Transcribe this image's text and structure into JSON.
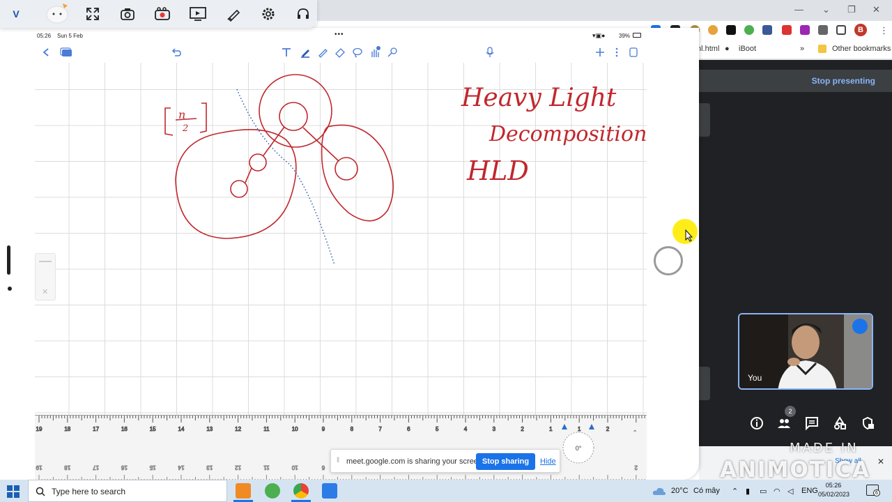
{
  "status_bar": {
    "time": "05:26",
    "date": "Sun 5 Feb",
    "battery": "39%"
  },
  "note_app": {
    "handwriting": {
      "heavy_light": "Heavy Light",
      "decomposition": "Decomposition",
      "hld": "HLD",
      "n_over_2_top": "n",
      "n_over_2_bottom": "2"
    },
    "ruler": {
      "top_ticks": [
        "19",
        "18",
        "17",
        "16",
        "15",
        "14",
        "13",
        "12",
        "11",
        "10",
        "9",
        "8",
        "7",
        "6",
        "5",
        "4",
        "3",
        "2",
        "1",
        "1",
        "2"
      ],
      "bottom_ticks": [
        "19",
        "18",
        "17",
        "16",
        "15",
        "14",
        "13",
        "12",
        "11",
        "10",
        "6",
        "2"
      ],
      "angle": "0°"
    }
  },
  "browser": {
    "bookmarks": {
      "html_tab": "nl.html",
      "iboot": "iBoot",
      "more": "»",
      "other_bookmarks": "Other bookmarks"
    },
    "profile_initial": "B"
  },
  "screen_share": {
    "message": "meet.google.com is sharing your screen.",
    "stop_button": "Stop sharing",
    "hide_link": "Hide"
  },
  "meet": {
    "stop_presenting": "Stop presenting",
    "self_label": "You",
    "people_count": "2",
    "show_all": "Show all"
  },
  "watermark": {
    "line1": "MADE IN",
    "line2": "ANIMOTICA"
  },
  "taskbar": {
    "search_placeholder": "Type here to search",
    "weather": "20°C",
    "weather_desc": "Có mây",
    "language": "ENG",
    "time": "05:26",
    "date": "05/02/2023",
    "notifications": "6"
  }
}
